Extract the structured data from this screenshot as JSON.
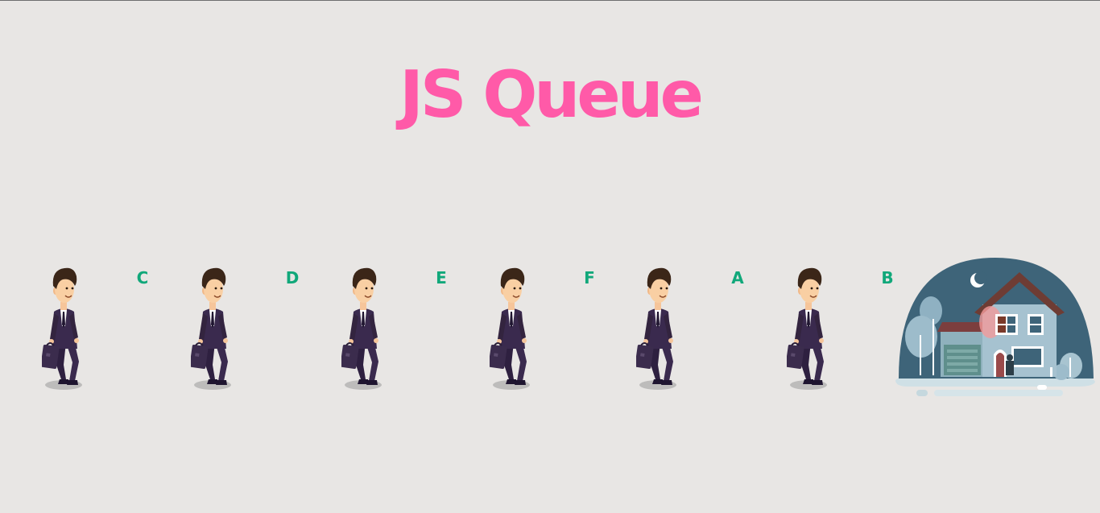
{
  "page": {
    "title": "JS Queue",
    "title_color": "#ff5aa8",
    "background": "#e8e6e4",
    "label_color": "#11a87a"
  },
  "queue": {
    "labels": [
      "C",
      "D",
      "E",
      "F",
      "A",
      "B"
    ],
    "person_icon": "businessman-with-briefcase",
    "destination_icon": "house-at-night"
  }
}
